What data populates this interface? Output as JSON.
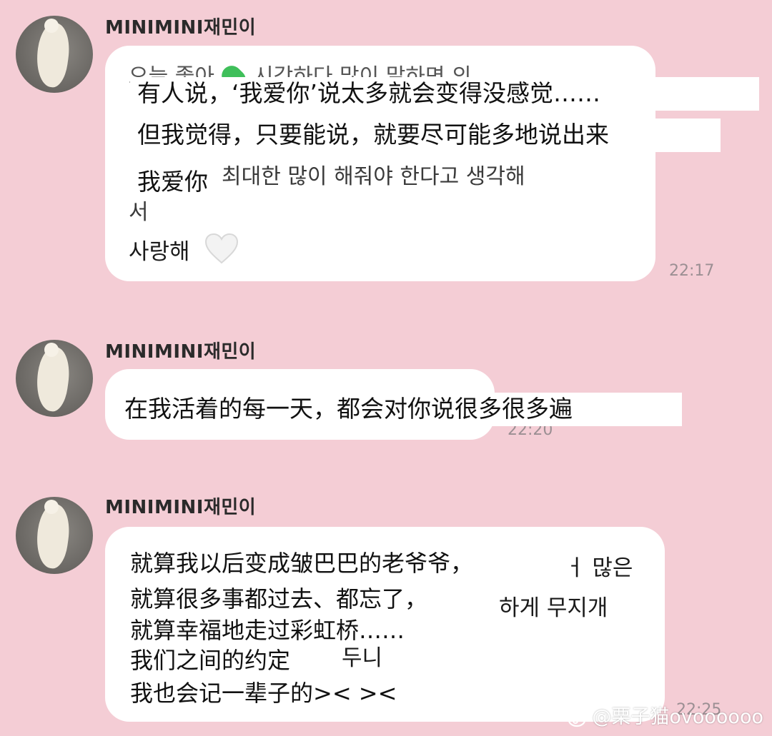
{
  "messages": [
    {
      "sender": "MINIMINI재민이",
      "time": "22:17",
      "ghost_lines": [
        "오늘 좋아",
        "시각하다 많이 말하면 의",
        "최대한 많이 해줘야 한다고 생각해",
        "서"
      ],
      "overlay_lines": [
        "有人说，‘我爱你’说太多就会变得没感觉……",
        "但我觉得，只要能说，就要尽可能多地说出来",
        "我爱你"
      ],
      "korean_text": "사랑해"
    },
    {
      "sender": "MINIMINI재민이",
      "time": "22:20",
      "overlay_lines": [
        "在我活着的每一天，都会对你说很多很多遍"
      ]
    },
    {
      "sender": "MINIMINI재민이",
      "time": "22:25",
      "lines": [
        "就算我以后变成皱巴巴的老爷爷，",
        "就算很多事都过去、都忘了，",
        "就算幸福地走过彩虹桥……",
        "我们之间的约定",
        "我也会记一辈子的>< ><"
      ],
      "korean_fragments": [
        "ㅓ 많은",
        "하게 무지개",
        "두니"
      ]
    }
  ],
  "watermark": "@栗子猫ovoooooo",
  "icons": {
    "avatar": "cat-avatar-icon",
    "green_heart": "green-heart-icon",
    "white_heart": "white-heart-icon",
    "weibo": "weibo-icon"
  }
}
